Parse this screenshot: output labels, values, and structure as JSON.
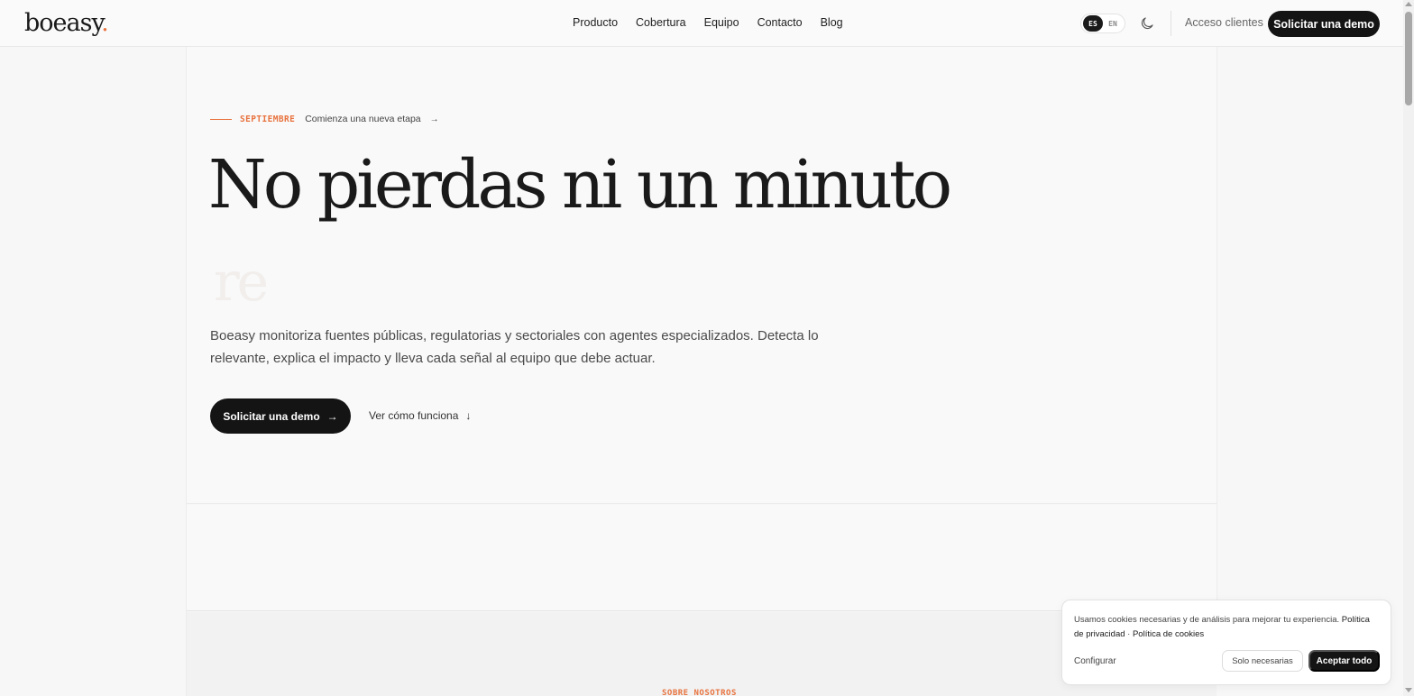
{
  "header": {
    "logo_text": "boeasy",
    "logo_dot": ".",
    "nav": [
      "Producto",
      "Cobertura",
      "Equipo",
      "Contacto",
      "Blog"
    ],
    "lang": {
      "es": "ES",
      "en": "EN",
      "active": "ES"
    },
    "theme_icon": "moon-icon",
    "client_login": "Acceso clientes",
    "demo_button": "Solicitar una demo"
  },
  "hero": {
    "eyebrow_tag": "SEPTIEMBRE",
    "eyebrow_text": "Comienza una nueva etapa",
    "eyebrow_arrow": "→",
    "headline": "No pierdas ni un minuto",
    "ghost_word": "re",
    "lead": "Boeasy monitoriza fuentes públicas, regulatorias y sectoriales con agentes especializados. Detecta lo relevante, explica el impacto y lleva cada señal al equipo que debe actuar.",
    "cta_primary": "Solicitar una demo",
    "cta_primary_arrow": "→",
    "cta_secondary": "Ver cómo funciona",
    "cta_secondary_arrow": "↓"
  },
  "about": {
    "tag": "SOBRE NOSOTROS"
  },
  "cookie": {
    "text": "Usamos cookies necesarias y de análisis para mejorar tu experiencia.",
    "privacy": "Política de privacidad",
    "separator": " · ",
    "cookies_policy": "Política de cookies",
    "configure": "Configurar",
    "necessary": "Solo necesarias",
    "accept": "Aceptar todo"
  },
  "colors": {
    "accent": "#e8733f",
    "dark": "#141414",
    "background": "#f7f7f7"
  }
}
